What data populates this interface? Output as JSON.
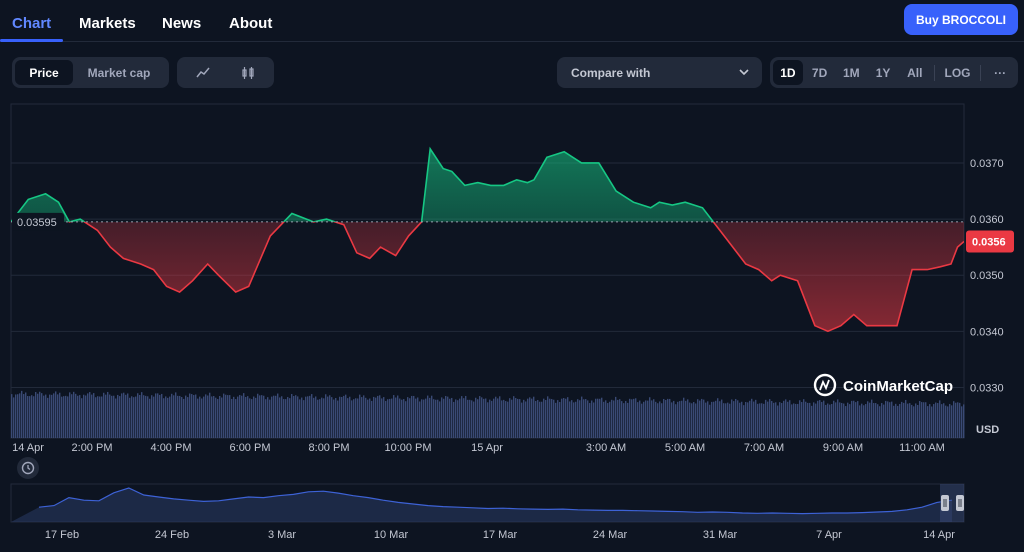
{
  "nav": {
    "tabs": [
      {
        "label": "Chart"
      },
      {
        "label": "Markets"
      },
      {
        "label": "News"
      },
      {
        "label": "About"
      }
    ],
    "buy_label": "Buy BROCCOLI"
  },
  "toolbar": {
    "type_toggle": [
      "Price",
      "Market cap"
    ],
    "selected_type": "Price",
    "compare_label": "Compare with",
    "ranges": [
      "1D",
      "7D",
      "1M",
      "1Y",
      "All"
    ],
    "selected_range": "1D",
    "log_label": "LOG",
    "more_label": "···"
  },
  "chart_data": [
    {
      "type": "line",
      "subtype": "baseline-area",
      "x_tick_labels": [
        "14 Apr",
        "2:00 PM",
        "4:00 PM",
        "6:00 PM",
        "8:00 PM",
        "10:00 PM",
        "15 Apr",
        "3:00 AM",
        "5:00 AM",
        "7:00 AM",
        "9:00 AM",
        "11:00 AM"
      ],
      "y_tick_labels": [
        "0.0330",
        "0.0340",
        "0.0350",
        "0.0360",
        "0.0370"
      ],
      "ylim": [
        0.0321,
        0.03805
      ],
      "unit_label": "USD",
      "baseline_value": 0.03595,
      "baseline_label": "0.03595",
      "current_value": 0.0356,
      "current_label": "0.0356",
      "colors": {
        "above": "#16c784",
        "below": "#ea3943",
        "volume": "#3a4a75"
      },
      "watermark": "CoinMarketCap",
      "series": [
        {
          "x": [
            0.0,
            0.4,
            0.8,
            1.1,
            1.35,
            1.6,
            2.0,
            2.3,
            2.6,
            3.0,
            3.3,
            3.6,
            3.9,
            4.2,
            4.55,
            4.8,
            5.2,
            5.5,
            6.0,
            6.5,
            7.0,
            7.3,
            7.7,
            8.0,
            8.3,
            8.55,
            8.9,
            9.2,
            9.5,
            9.7,
            10.0,
            10.2,
            10.5,
            10.8,
            11.1,
            11.4,
            11.7,
            11.95,
            12.1,
            12.4,
            12.8,
            13.2,
            13.6,
            14.0,
            14.4,
            14.8,
            15.0,
            15.3,
            15.6,
            16.0,
            16.4,
            16.7,
            17.0,
            17.3,
            17.6,
            17.8,
            18.2,
            18.6,
            18.9,
            19.2,
            19.5,
            19.8,
            20.1,
            20.5,
            20.85,
            21.2,
            21.5,
            21.75,
            21.9,
            22.05
          ],
          "values": [
            0.03595,
            0.03635,
            0.03645,
            0.0363,
            0.03595,
            0.036,
            0.0358,
            0.0355,
            0.0353,
            0.0352,
            0.0351,
            0.0348,
            0.0347,
            0.0349,
            0.0352,
            0.035,
            0.0347,
            0.0348,
            0.0357,
            0.0361,
            0.03595,
            0.036,
            0.0359,
            0.0354,
            0.0353,
            0.0355,
            0.03535,
            0.0357,
            0.03595,
            0.03725,
            0.0369,
            0.03685,
            0.0366,
            0.03665,
            0.0366,
            0.0366,
            0.0367,
            0.03665,
            0.0367,
            0.0371,
            0.0372,
            0.037,
            0.037,
            0.0365,
            0.0363,
            0.0362,
            0.0363,
            0.03625,
            0.0363,
            0.0362,
            0.0358,
            0.0355,
            0.0352,
            0.0351,
            0.0349,
            0.035,
            0.0349,
            0.0341,
            0.034,
            0.0341,
            0.0343,
            0.0341,
            0.0341,
            0.0341,
            0.0351,
            0.0351,
            0.03515,
            0.0352,
            0.0355,
            0.0356
          ]
        }
      ]
    },
    {
      "type": "area",
      "role": "navigator",
      "x_tick_labels": [
        "17 Feb",
        "24 Feb",
        "3 Mar",
        "10 Mar",
        "17 Mar",
        "24 Mar",
        "31 Mar",
        "7 Apr",
        "14 Apr"
      ],
      "values": [
        0.4,
        0.45,
        0.7,
        0.62,
        0.6,
        0.85,
        1.0,
        0.78,
        0.72,
        0.66,
        0.62,
        0.58,
        0.6,
        0.66,
        0.72,
        0.7,
        0.76,
        0.8,
        0.88,
        0.9,
        0.84,
        0.76,
        0.7,
        0.62,
        0.55,
        0.5,
        0.45,
        0.42,
        0.4,
        0.38,
        0.36,
        0.37,
        0.35,
        0.34,
        0.33,
        0.34,
        0.32,
        0.31,
        0.3,
        0.3,
        0.29,
        0.28,
        0.27,
        0.26,
        0.24,
        0.25,
        0.24,
        0.22,
        0.21,
        0.22,
        0.21,
        0.2,
        0.21,
        0.22,
        0.22,
        0.23,
        0.25,
        0.27,
        0.32,
        0.4,
        0.55,
        0.62
      ]
    }
  ]
}
